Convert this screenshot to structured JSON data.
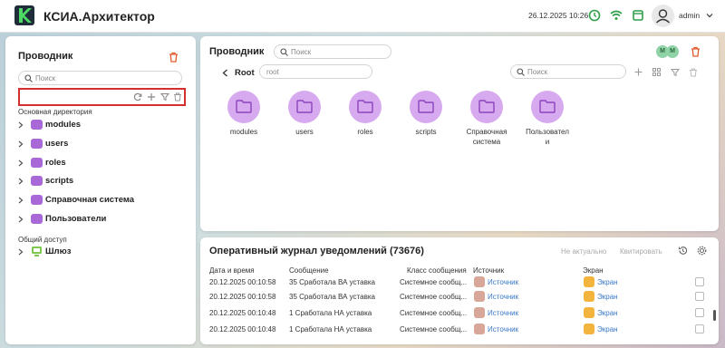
{
  "app": {
    "title": "КСИА.Архитектор",
    "datetime": "26.12.2025 10:26",
    "user": "admin"
  },
  "left": {
    "title": "Проводник",
    "search_placeholder": "Поиск",
    "section_main": "Основная директория",
    "items": [
      {
        "label": "modules"
      },
      {
        "label": "users"
      },
      {
        "label": "roles"
      },
      {
        "label": "scripts"
      },
      {
        "label": "Справочная система"
      },
      {
        "label": "Пользователи"
      }
    ],
    "section_shared": "Общий доступ",
    "gateway": "Шлюз"
  },
  "explorer": {
    "title": "Проводник",
    "search_placeholder": "Поиск",
    "badges": [
      "М",
      "М"
    ],
    "root_label": "Root",
    "path_value": "root",
    "search2_placeholder": "Поиск",
    "folders": [
      {
        "label": "modules"
      },
      {
        "label": "users"
      },
      {
        "label": "roles"
      },
      {
        "label": "scripts"
      },
      {
        "label": "Справочная система"
      },
      {
        "label": "Пользовател и"
      }
    ]
  },
  "journal": {
    "title": "Оперативный журнал уведомлений (73676)",
    "btn_not_actual": "Не актуально",
    "btn_ack": "Квитировать",
    "columns": [
      "Дата и время",
      "Сообщение",
      "Класс сообщения",
      "Источник",
      "Экран"
    ],
    "rows": [
      {
        "date": "20.12.2025 00:10:58",
        "message": "35 Сработала ВА уставка",
        "class": "Системное сообщ...",
        "source": "Источник",
        "screen": "Экран"
      },
      {
        "date": "20.12.2025 00:10:58",
        "message": "35 Сработала ВА уставка",
        "class": "Системное сообщ...",
        "source": "Источник",
        "screen": "Экран"
      },
      {
        "date": "20.12.2025 00:10:48",
        "message": "1 Сработала НА уставка",
        "class": "Системное сообщ...",
        "source": "Источник",
        "screen": "Экран"
      },
      {
        "date": "20.12.2025 00:10:48",
        "message": "1 Сработала НА уставка",
        "class": "Системное сообщ...",
        "source": "Источник",
        "screen": "Экран"
      }
    ]
  },
  "colors": {
    "accent": "#2e9e48",
    "folder": "#a968d8",
    "folder_circle": "#d7aaef",
    "delete": "#e05a2b",
    "link": "#3a78c9"
  }
}
